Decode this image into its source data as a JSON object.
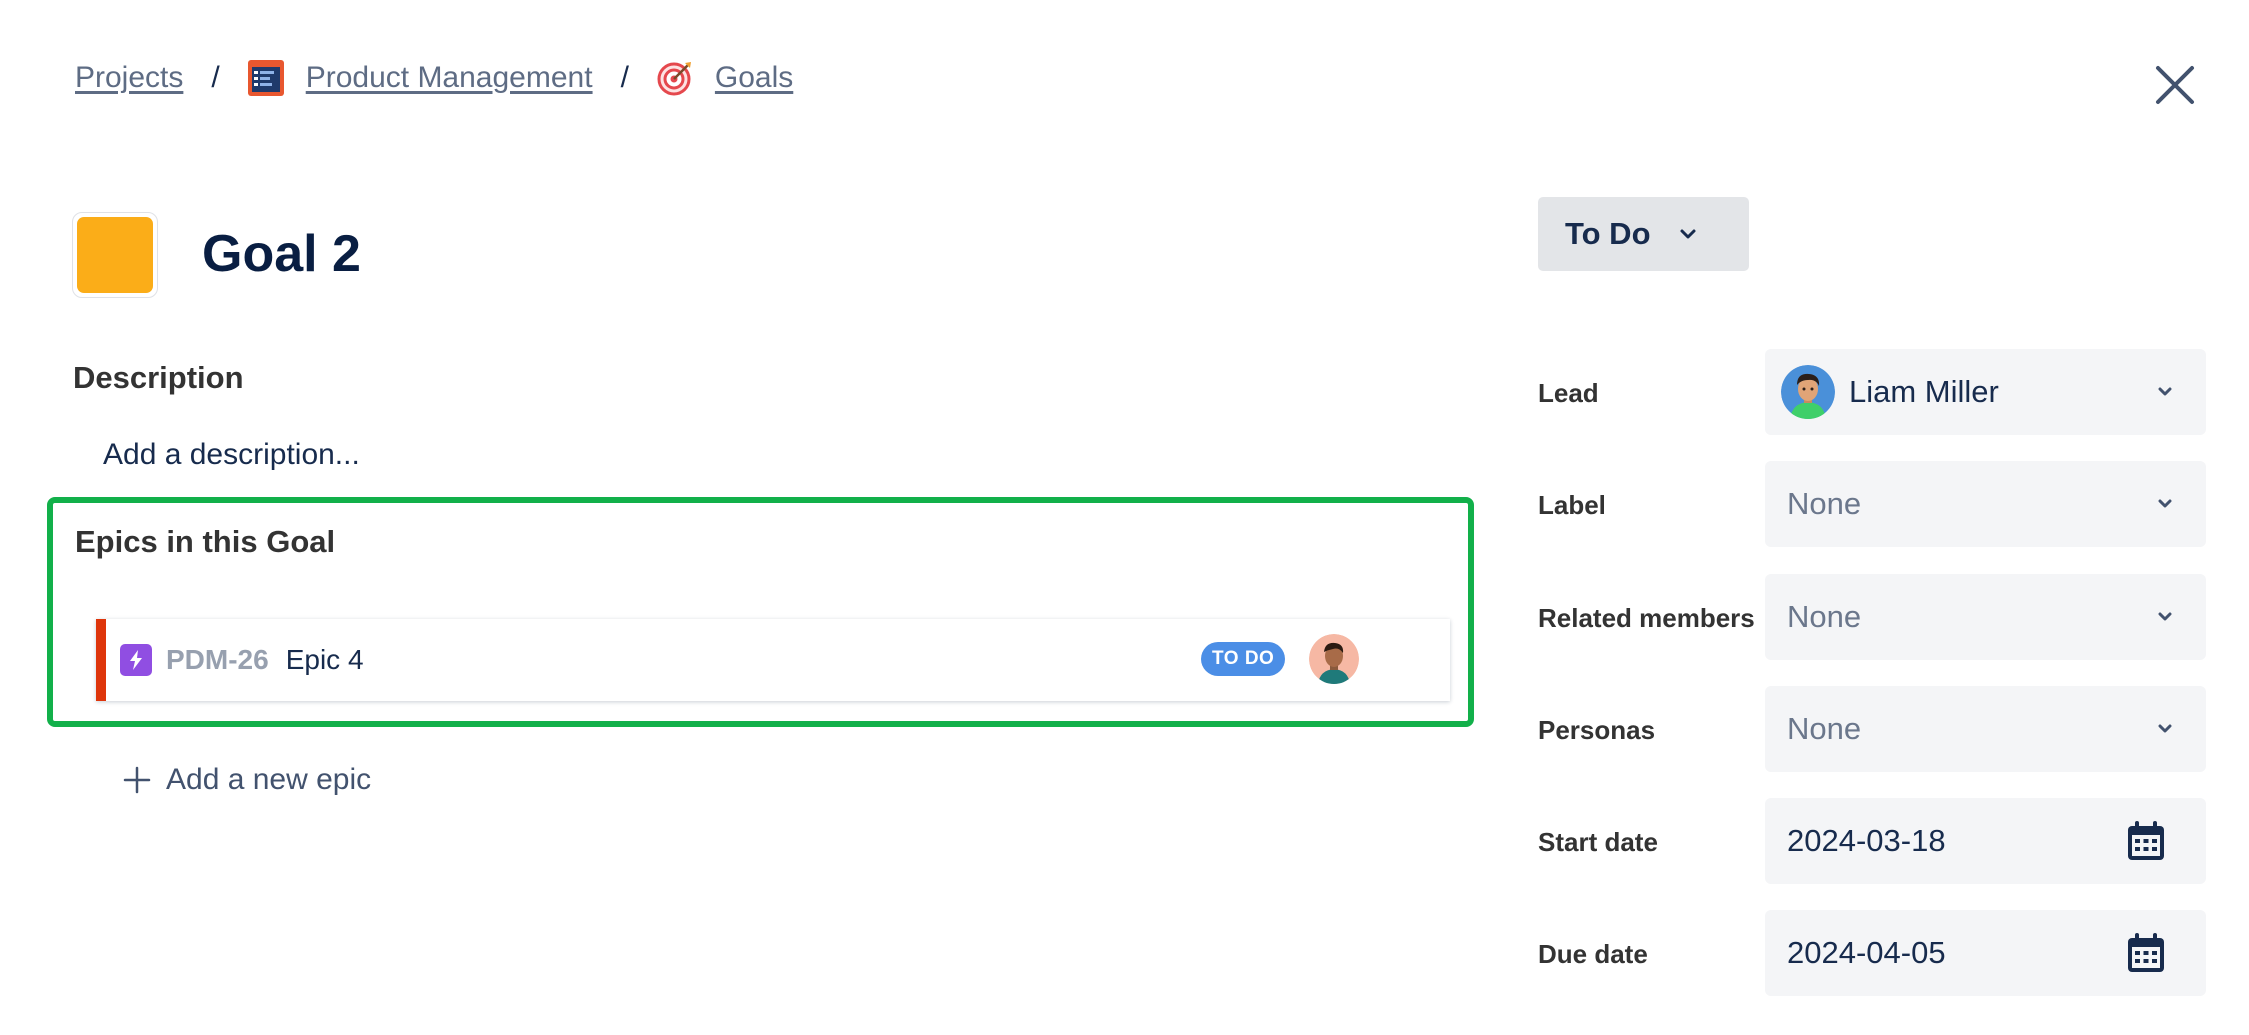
{
  "breadcrumb": {
    "projects": "Projects",
    "separator": "/",
    "product": "Product Management",
    "goals": "Goals"
  },
  "goal": {
    "title": "Goal 2",
    "color": "#FBAD18"
  },
  "description": {
    "heading": "Description",
    "placeholder": "Add a description..."
  },
  "epics": {
    "heading": "Epics in this Goal",
    "items": [
      {
        "key": "PDM-26",
        "name": "Epic 4",
        "status": "TO DO",
        "color": "#DE350B",
        "status_color": "#4B8EE6"
      }
    ],
    "add_label": "Add a new epic"
  },
  "status": {
    "label": "To Do"
  },
  "fields": {
    "lead": {
      "label": "Lead",
      "value": "Liam Miller"
    },
    "label": {
      "label": "Label",
      "value": "None"
    },
    "related_members": {
      "label": "Related members",
      "value": "None"
    },
    "personas": {
      "label": "Personas",
      "value": "None"
    },
    "start_date": {
      "label": "Start date",
      "value": "2024-03-18"
    },
    "due_date": {
      "label": "Due date",
      "value": "2024-04-05"
    }
  },
  "colors": {
    "highlight_border": "#12B04A",
    "link": "#5E6C84",
    "field_bg": "#F4F5F7"
  },
  "icons": {
    "product": "product-management-icon",
    "goals": "goals-target-icon",
    "close": "close-icon",
    "epic": "lightning-icon",
    "add": "plus-icon",
    "calendar": "calendar-icon",
    "chevron": "chevron-down-icon"
  }
}
